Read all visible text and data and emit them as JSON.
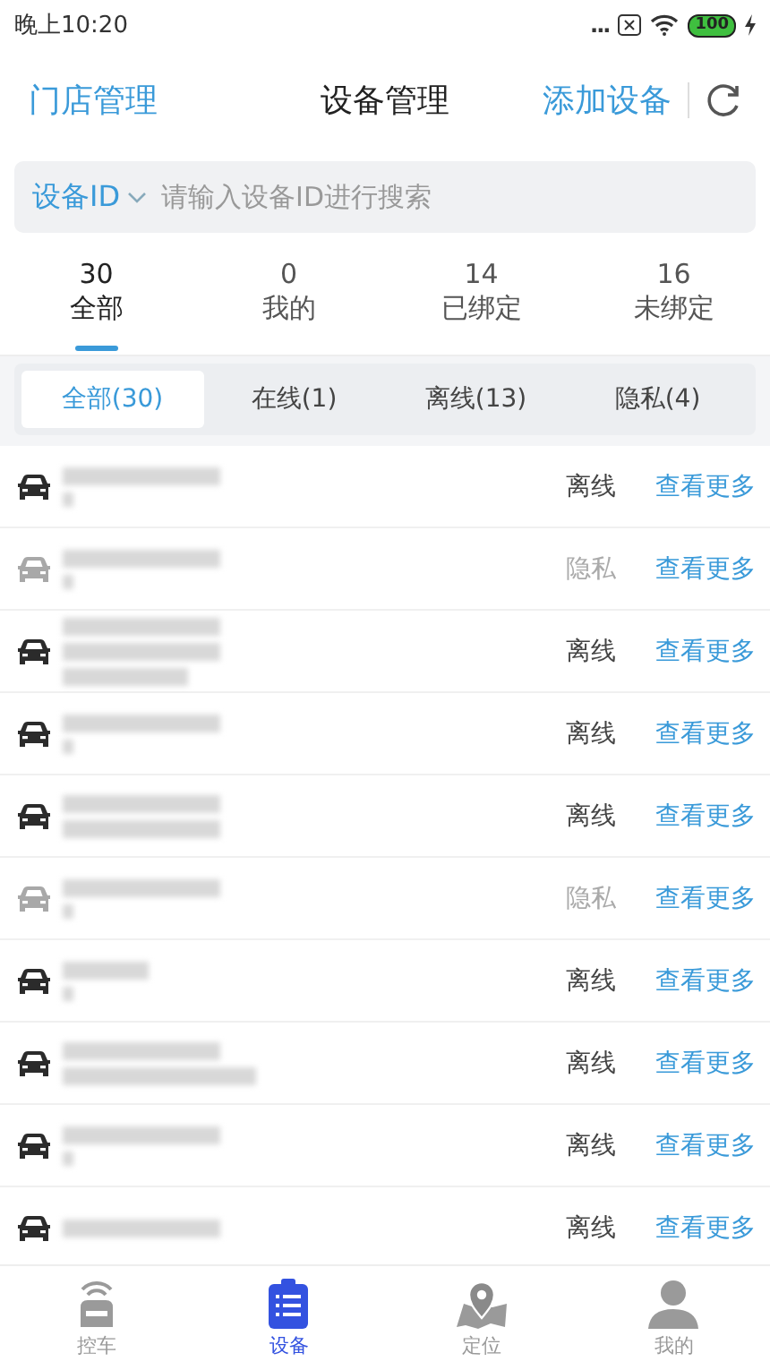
{
  "status_bar": {
    "time": "晚上10:20",
    "dots": "...",
    "battery": "100"
  },
  "header": {
    "left_link": "门店管理",
    "title": "设备管理",
    "right_link": "添加设备"
  },
  "search": {
    "field_type": "设备ID",
    "placeholder": "请输入设备ID进行搜索"
  },
  "count_tabs": [
    {
      "count": "30",
      "label": "全部",
      "selected": true
    },
    {
      "count": "0",
      "label": "我的",
      "selected": false
    },
    {
      "count": "14",
      "label": "已绑定",
      "selected": false
    },
    {
      "count": "16",
      "label": "未绑定",
      "selected": false
    }
  ],
  "filters": [
    {
      "label": "全部(30)",
      "selected": true
    },
    {
      "label": "在线(1)",
      "selected": false
    },
    {
      "label": "离线(13)",
      "selected": false
    },
    {
      "label": "隐私(4)",
      "selected": false
    }
  ],
  "devices": [
    {
      "kind": "offline",
      "status": "离线",
      "action": "查看更多"
    },
    {
      "kind": "private",
      "status": "隐私",
      "action": "查看更多"
    },
    {
      "kind": "offline",
      "status": "离线",
      "action": "查看更多"
    },
    {
      "kind": "offline",
      "status": "离线",
      "action": "查看更多"
    },
    {
      "kind": "offline",
      "status": "离线",
      "action": "查看更多"
    },
    {
      "kind": "private",
      "status": "隐私",
      "action": "查看更多"
    },
    {
      "kind": "offline",
      "status": "离线",
      "action": "查看更多"
    },
    {
      "kind": "offline",
      "status": "离线",
      "action": "查看更多"
    },
    {
      "kind": "offline",
      "status": "离线",
      "action": "查看更多"
    },
    {
      "kind": "offline",
      "status": "离线",
      "action": "查看更多"
    }
  ],
  "bottom_nav": [
    {
      "label": "控车",
      "selected": false
    },
    {
      "label": "设备",
      "selected": true
    },
    {
      "label": "定位",
      "selected": false
    },
    {
      "label": "我的",
      "selected": false
    }
  ]
}
